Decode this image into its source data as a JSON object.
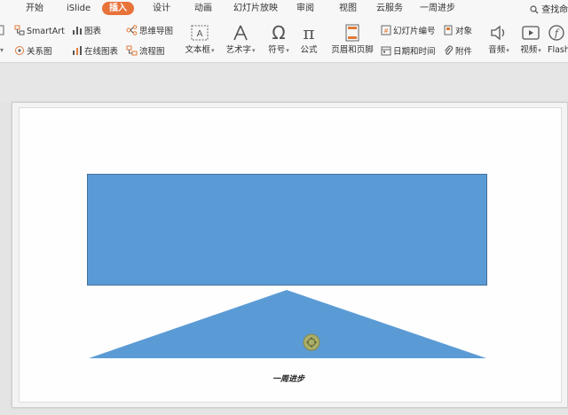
{
  "menu": {
    "tabs": [
      "开始",
      "iSlide",
      "插入",
      "设计",
      "动画",
      "幻灯片放映",
      "审阅",
      "视图",
      "云服务",
      "一周进步"
    ],
    "active_tab": "插入",
    "search_label": "查找命"
  },
  "ribbon": {
    "smartart": "SmartArt",
    "chart": "图表",
    "mindmap": "思维导图",
    "relation": "关系图",
    "online_chart": "在线图表",
    "flowchart": "流程图",
    "textbox": "文本框",
    "wordart": "艺术字",
    "symbol": "符号",
    "formula": "公式",
    "header_footer": "页眉和页脚",
    "slide_number": "幻灯片编号",
    "object": "对象",
    "datetime": "日期和时间",
    "attachment": "附件",
    "audio": "音频",
    "video": "视频",
    "flash": "Flash"
  },
  "slide": {
    "footer_text": "一周进步",
    "shape_color": "#5b9bd5",
    "shape_border": "#41719c",
    "accent": "#e8733a"
  }
}
